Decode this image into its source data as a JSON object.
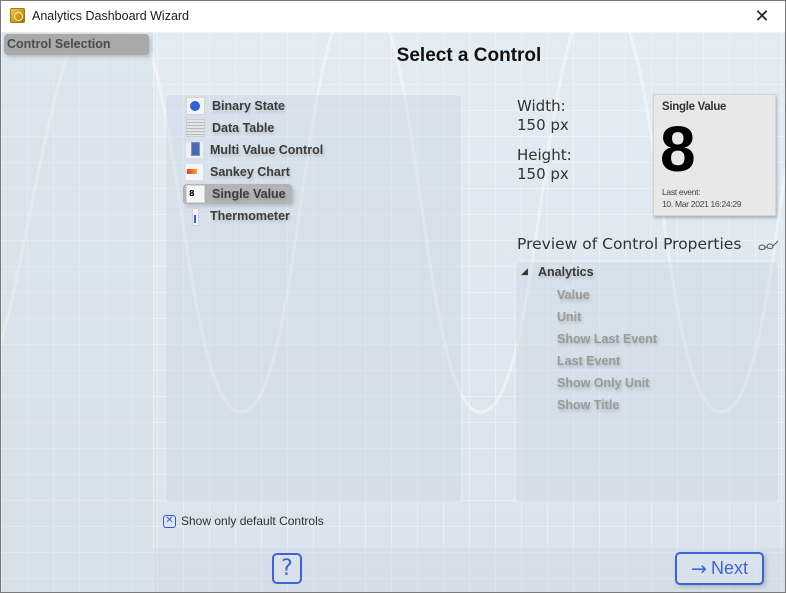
{
  "window": {
    "title": "Analytics Dashboard Wizard",
    "close_icon": "close-icon"
  },
  "sidebar": {
    "items": [
      {
        "label": "Control Selection",
        "selected": true
      }
    ]
  },
  "main": {
    "title": "Select a Control",
    "controls": [
      {
        "label": "Binary State",
        "icon": "binary-state-icon",
        "selected": false
      },
      {
        "label": "Data Table",
        "icon": "data-table-icon",
        "selected": false
      },
      {
        "label": "Multi Value Control",
        "icon": "multi-value-icon",
        "selected": false
      },
      {
        "label": "Sankey Chart",
        "icon": "sankey-chart-icon",
        "selected": false
      },
      {
        "label": "Single Value",
        "icon": "single-value-icon",
        "selected": true
      },
      {
        "label": "Thermometer",
        "icon": "thermometer-icon",
        "selected": false
      }
    ],
    "dimensions": {
      "width_label": "Width:",
      "width_value": "150 px",
      "height_label": "Height:",
      "height_value": "150 px"
    },
    "preview_card": {
      "title": "Single Value",
      "value": "8",
      "last_event_label": "Last event:",
      "last_event_value": "10. Mar 2021 16:24:29"
    },
    "properties": {
      "title": "Preview of Control Properties",
      "toggle_icon": "glasses-icon",
      "group": {
        "label": "Analytics",
        "expanded": true,
        "children": [
          "Value",
          "Unit",
          "Show Last Event",
          "Last Event",
          "Show Only Unit",
          "Show Title"
        ]
      }
    },
    "filter": {
      "label": "Show only default Controls",
      "checked": true
    }
  },
  "footer": {
    "help_label": "?",
    "next_arrow": "→",
    "next_label": "Next"
  },
  "colors": {
    "accent": "#3d63dc",
    "selected_bg": "#b4b4b4",
    "background": "#dfe7ef"
  }
}
